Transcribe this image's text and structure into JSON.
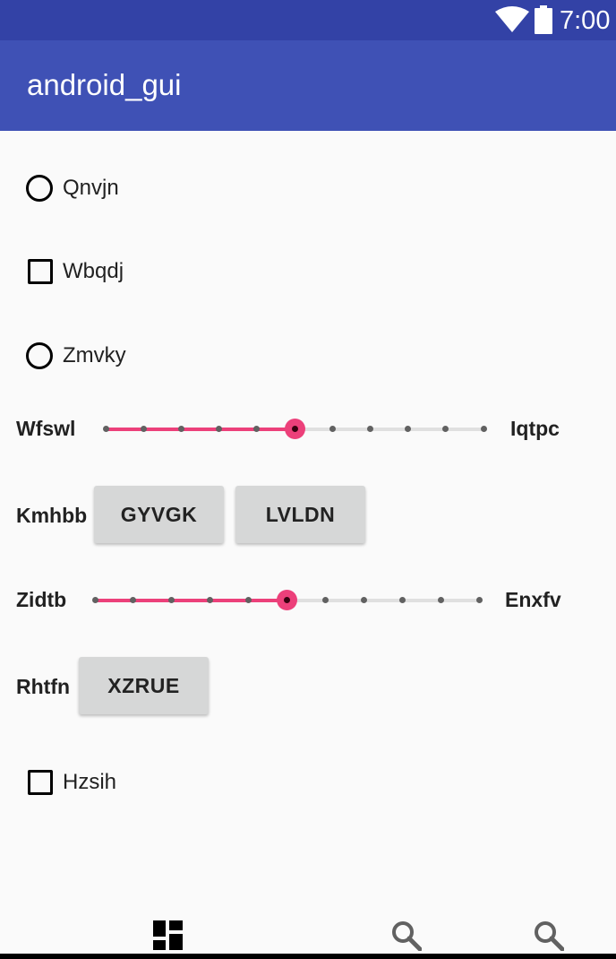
{
  "status_bar": {
    "time": "7:00",
    "icons": [
      "wifi-icon",
      "battery-icon"
    ],
    "background": "#3342a6"
  },
  "app_bar": {
    "title": "android_gui",
    "background": "#3f51b5"
  },
  "controls": {
    "radio_1": {
      "label": "Qnvjn",
      "checked": false
    },
    "checkbox_1": {
      "label": "Wbqdj",
      "checked": false
    },
    "radio_2": {
      "label": "Zmvky",
      "checked": false
    },
    "seekbar_1": {
      "left_label": "Wfswl",
      "right_label": "Iqtpc",
      "progress": 5,
      "max": 10
    },
    "button_row_1": {
      "label": "Kmhbb",
      "buttons": [
        "GYVGK",
        "LVLDN"
      ]
    },
    "seekbar_2": {
      "left_label": "Zidtb",
      "right_label": "Enxfv",
      "progress": 5,
      "max": 10
    },
    "button_row_2": {
      "label": "Rhtfn",
      "buttons": [
        "XZRUE"
      ]
    },
    "checkbox_2": {
      "label": "Hzsih",
      "checked": false
    }
  },
  "bottom_nav": {
    "items": [
      "dashboard-icon",
      "search-icon",
      "search-icon"
    ]
  },
  "accent_color": "#ec407a"
}
